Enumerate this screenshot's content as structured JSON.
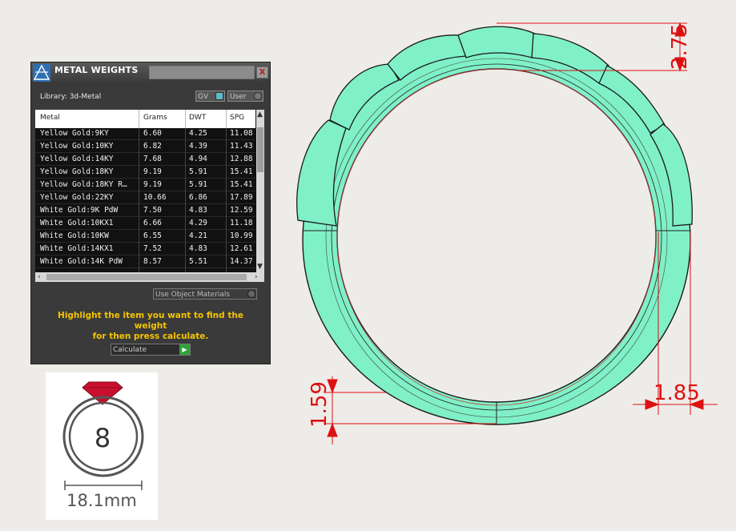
{
  "panel": {
    "title": "METAL WEIGHTS",
    "close_label": "X",
    "library_label": "Library: 3d-Metal",
    "gv_toggle_label": "GV",
    "user_toggle_label": "User",
    "columns": [
      "Metal",
      "Grams",
      "DWT",
      "SPG"
    ],
    "rows": [
      [
        "Yellow Gold:9KY",
        "6.60",
        "4.25",
        "11.08"
      ],
      [
        "Yellow Gold:10KY",
        "6.82",
        "4.39",
        "11.43"
      ],
      [
        "Yellow Gold:14KY",
        "7.68",
        "4.94",
        "12.88"
      ],
      [
        "Yellow Gold:18KY",
        "9.19",
        "5.91",
        "15.41"
      ],
      [
        "Yellow Gold:18KY R…",
        "9.19",
        "5.91",
        "15.41"
      ],
      [
        "Yellow Gold:22KY",
        "10.66",
        "6.86",
        "17.89"
      ],
      [
        "White Gold:9K PdW",
        "7.50",
        "4.83",
        "12.59"
      ],
      [
        "White Gold:10KX1",
        "6.66",
        "4.29",
        "11.18"
      ],
      [
        "White Gold:10KW",
        "6.55",
        "4.21",
        "10.99"
      ],
      [
        "White Gold:14KX1",
        "7.52",
        "4.83",
        "12.61"
      ],
      [
        "White Gold:14K PdW",
        "8.57",
        "5.51",
        "14.37"
      ]
    ],
    "use_object_materials_label": "Use Object Materials",
    "hint_line1": "Highlight the item you want to find the weight",
    "hint_line2": "for then press calculate.",
    "calculate_label": "Calculate"
  },
  "ring_size_card": {
    "size": "8",
    "diameter": "18.1mm",
    "gem_color": "#c8102e"
  },
  "dimensions": {
    "top_height": "2.75",
    "bottom_height": "1.59",
    "band_width": "1.85"
  },
  "colors": {
    "ring_fill": "#7ff0c8",
    "dimension_lines": "#dd1111",
    "panel_background": "#3a3a3a",
    "hint_text": "#f5c400"
  }
}
